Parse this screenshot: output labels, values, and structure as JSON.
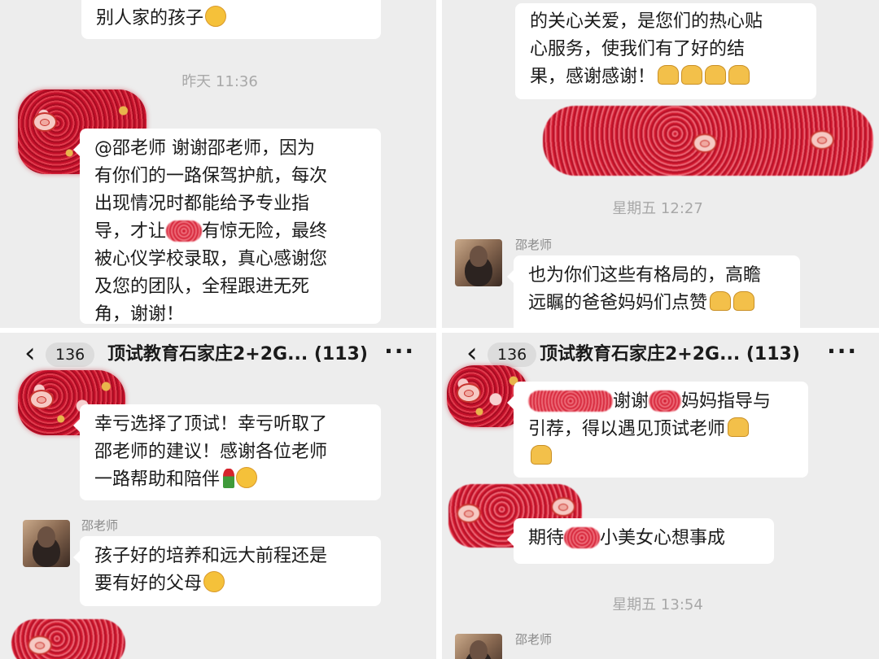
{
  "panel1": {
    "top_bubble": "别人家的孩子",
    "timestamp": "昨天 11:36",
    "message": "@邵老师 谢谢邵老师，因为\n有你们的一路保驾护航，每次\n出现情况时都能给予专业指\n导，才让",
    "message_after_redact": "有惊无险，最终\n被心仪学校录取，真心感谢您\n及您的团队，全程跟进无死\n角，谢谢！"
  },
  "panel2": {
    "top_bubble": "的关心关爱，是您们的热心贴\n心服务，使我们有了好的结\n果，感谢感谢！",
    "timestamp": "星期五 12:27",
    "sender": "邵老师",
    "message": "也为你们这些有格局的，高瞻\n远瞩的爸爸妈妈们点赞"
  },
  "panel3": {
    "header": {
      "back_count": "136",
      "title": "顶试教育石家庄2+2G... (113)",
      "more": "···"
    },
    "message1": "幸亏选择了顶试！幸亏听取了\n邵老师的建议！感谢各位老师\n一路帮助和陪伴",
    "sender": "邵老师",
    "message2": "孩子好的培养和远大前程还是\n要有好的父母"
  },
  "panel4": {
    "header": {
      "back_count": "136",
      "title": "顶试教育石家庄2+2G... (113)",
      "more": "···"
    },
    "message1_a": "谢谢",
    "message1_b": "妈妈指导与\n引荐，得以遇见顶试老师",
    "message2_a": "期待",
    "message2_b": "小美女心想事成",
    "timestamp": "星期五 13:54",
    "sender": "邵老师"
  },
  "colors": {
    "chat_bg": "#ededed",
    "bubble": "#ffffff",
    "glitter_red": "#c3102a"
  }
}
